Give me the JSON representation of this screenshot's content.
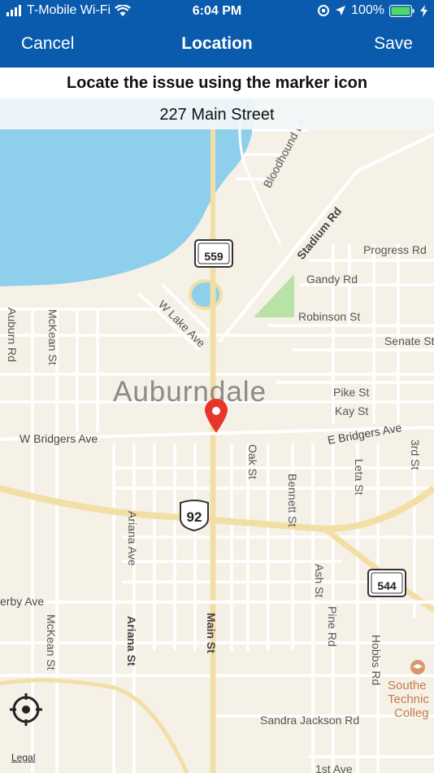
{
  "status": {
    "carrier": "T-Mobile Wi-Fi",
    "time": "6:04 PM",
    "battery": "100%",
    "icons": [
      "signal-icon",
      "wifi-icon",
      "orientation-lock-icon",
      "location-arrow-icon",
      "battery-icon",
      "charging-icon"
    ]
  },
  "nav": {
    "cancel": "Cancel",
    "title": "Location",
    "save": "Save"
  },
  "instruction": "Locate the issue using the marker icon",
  "address": "227 Main Street",
  "map": {
    "city": "Auburndale",
    "roads": {
      "bloodhound": "Bloodhound Ln",
      "stadium": "Stadium Rd",
      "progress": "Progress Rd",
      "gandy": "Gandy Rd",
      "robinson": "Robinson St",
      "senate": "Senate St",
      "auburn": "Auburn Rd",
      "mckean_top": "McKean St",
      "wlake": "W Lake Ave",
      "pike": "Pike St",
      "kay": "Kay St",
      "wbridgers": "W Bridgers Ave",
      "ebridgers": "E Bridgers Ave",
      "oak": "Oak St",
      "leta": "Leta St",
      "third": "3rd St",
      "ariana_ave": "Ariana Ave",
      "bennett": "Bennett St",
      "derby": "erby Ave",
      "ash": "Ash St",
      "pine": "Pine Rd",
      "mckean_bottom": "McKean St",
      "ariana_st": "Ariana St",
      "main": "Main St",
      "hobbs": "Hobbs Rd",
      "sandra": "Sandra Jackson Rd",
      "first": "1st Ave"
    },
    "shields": {
      "sr559": "559",
      "us92": "92",
      "sr544": "544"
    },
    "poi": "Southern Technical College",
    "poi_lines": [
      "Southe",
      "Technic",
      "Colleg"
    ]
  },
  "legal": "Legal"
}
